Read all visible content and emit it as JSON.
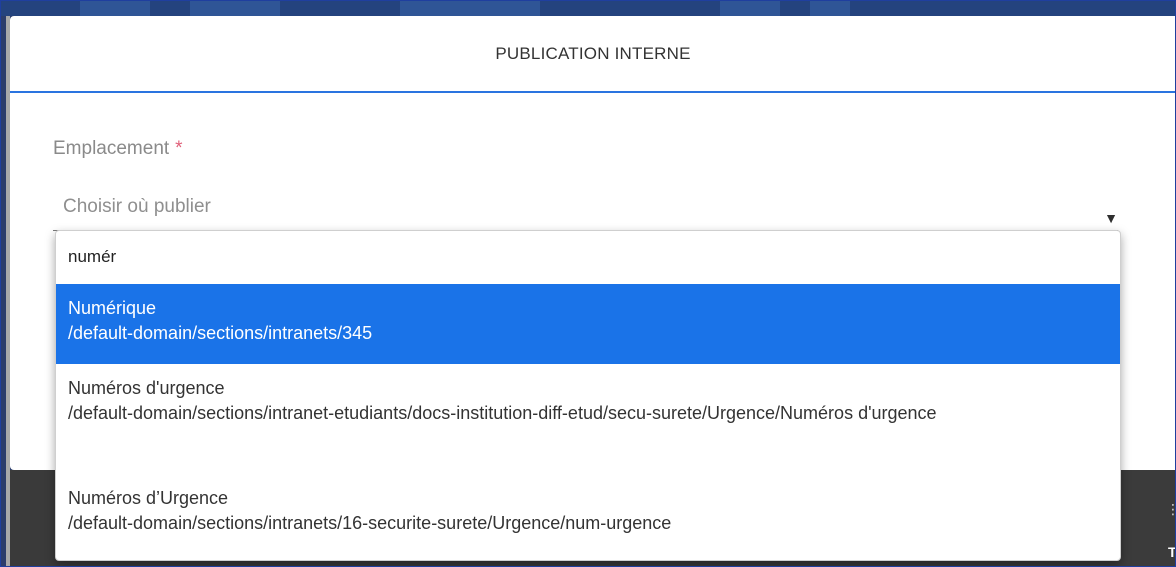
{
  "modal": {
    "title": "PUBLICATION INTERNE"
  },
  "field": {
    "label": "Emplacement",
    "required_marker": "*",
    "placeholder": "Choisir où publier"
  },
  "dropdown": {
    "search_value": "numér",
    "options": [
      {
        "title": "Numérique",
        "path": "/default-domain/sections/intranets/345",
        "selected": true
      },
      {
        "title": "Numéros d'urgence",
        "path": "/default-domain/sections/intranet-etudiants/docs-institution-diff-etud/secu-surete/Urgence/Numéros d'urgence",
        "selected": false
      },
      {
        "title": "Numéros d’Urgence",
        "path": "/default-domain/sections/intranets/16-securite-surete/Urgence/num-urgence",
        "selected": false
      }
    ]
  },
  "colors": {
    "accent": "#1a73e8",
    "header_border": "#2a74e0",
    "required": "#e0607a"
  },
  "icons": {
    "select_arrow": "caret-down-icon"
  }
}
